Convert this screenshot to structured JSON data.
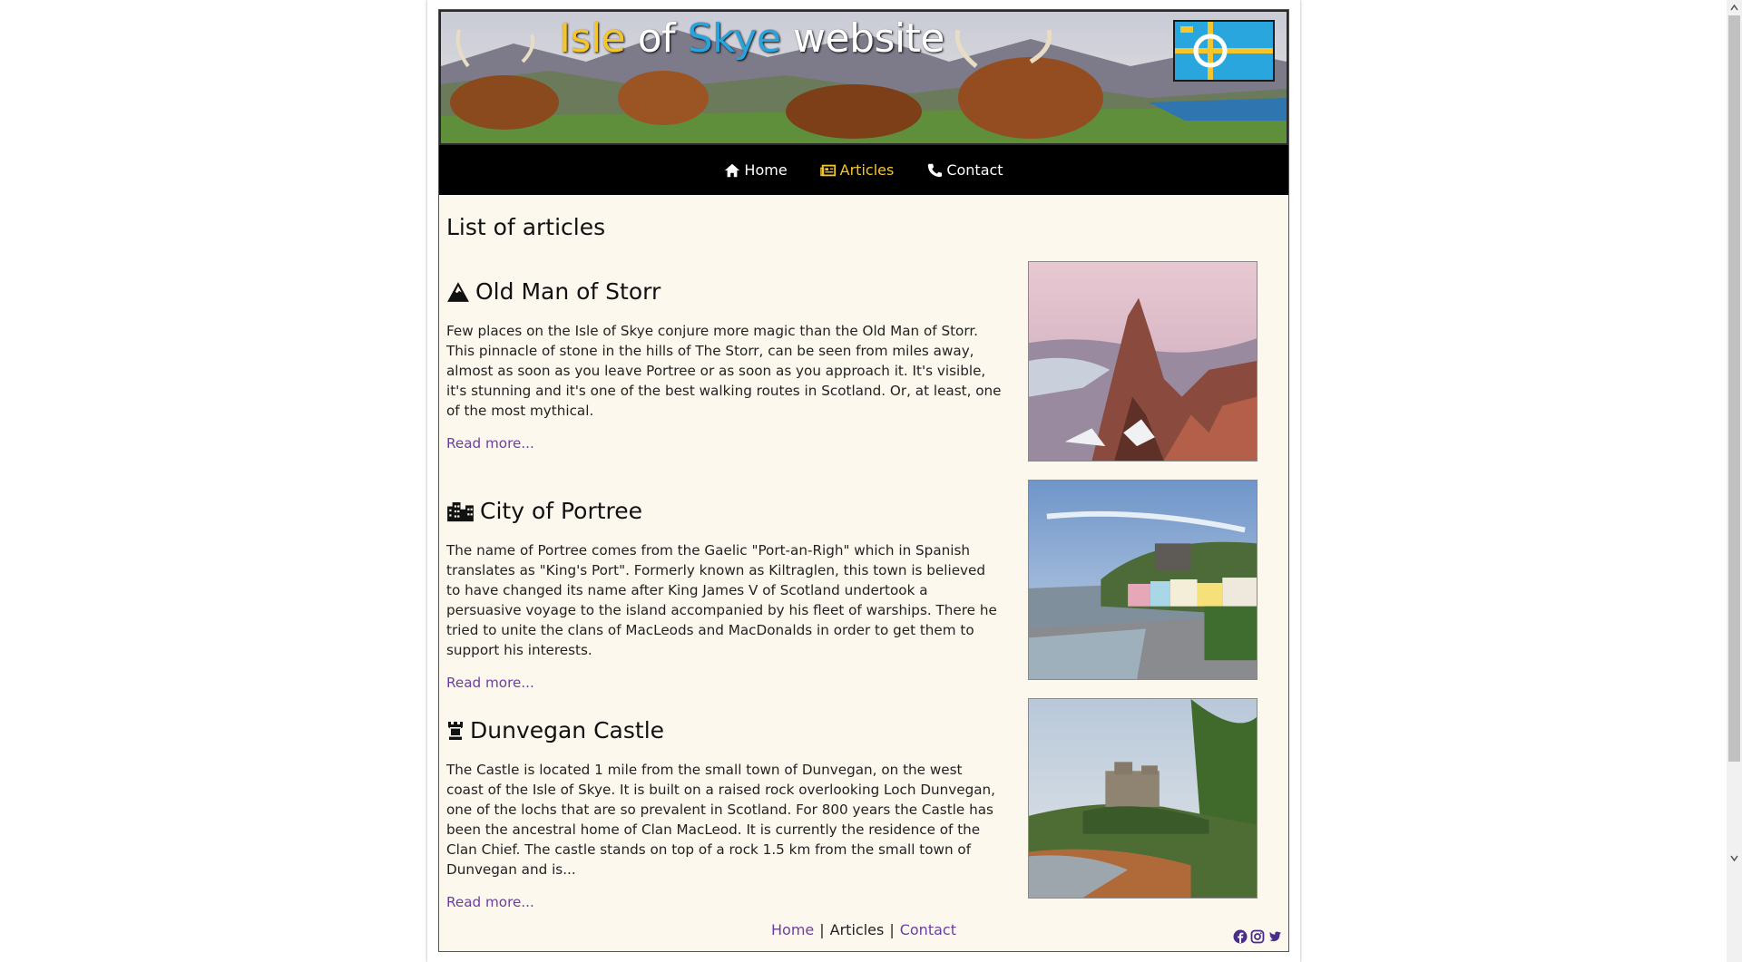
{
  "banner": {
    "title_part1": "Isle",
    "title_part2": " of ",
    "title_part3": "Skye",
    "title_part4": " website",
    "flag_icon": "isle-of-skye-flag"
  },
  "nav": {
    "items": [
      {
        "label": "Home",
        "icon": "home-icon",
        "active": false
      },
      {
        "label": "Articles",
        "icon": "newspaper-icon",
        "active": true
      },
      {
        "label": "Contact",
        "icon": "phone-icon",
        "active": false
      }
    ]
  },
  "main": {
    "title": "List of articles",
    "articles": [
      {
        "icon": "mountain-icon",
        "title": "Old Man of Storr",
        "text": "Few places on the Isle of Skye conjure more magic than the Old Man of Storr. This pinnacle of stone in the hills of The Storr, can be seen from miles away, almost as soon as you leave Portree or as soon as you approach it. It's visible, it's stunning and it's one of the best walking routes in Scotland. Or, at least, one of the most mythical.",
        "link": "Read more..."
      },
      {
        "icon": "city-icon",
        "title": "City of Portree",
        "text": "The name of Portree comes from the Gaelic \"Port-an-Righ\" which in Spanish translates as \"King's Port\". Formerly known as Kiltraglen, this town is believed to have changed its name after King James V of Scotland undertook a persuasive voyage to the island accompanied by his fleet of warships. There he tried to unite the clans of MacLeods and MacDonalds in order to get them to support his interests.",
        "link": "Read more..."
      },
      {
        "icon": "chess-rook-icon",
        "title": "Dunvegan Castle",
        "text": "The Castle is located 1 mile from the small town of Dunvegan, on the west coast of the Isle of Skye. It is built on a raised rock overlooking Loch Dunvegan, one of the lochs that are so prevalent in Scotland. For 800 years the Castle has been the ancestral home of Clan MacLeod. It is currently the residence of the Clan Chief. The castle stands on top of a rock 1.5 km from the small town of Dunvegan and is...",
        "link": "Read more..."
      }
    ]
  },
  "footer": {
    "links": [
      "Home",
      "Articles",
      "Contact"
    ],
    "separator": "|",
    "social_icons": [
      "facebook-icon",
      "instagram-icon",
      "twitter-icon"
    ]
  },
  "colors": {
    "accent": "#f5c62c",
    "link": "#6b3fa0",
    "background": "#fdf8ee",
    "nav": "#000000"
  }
}
